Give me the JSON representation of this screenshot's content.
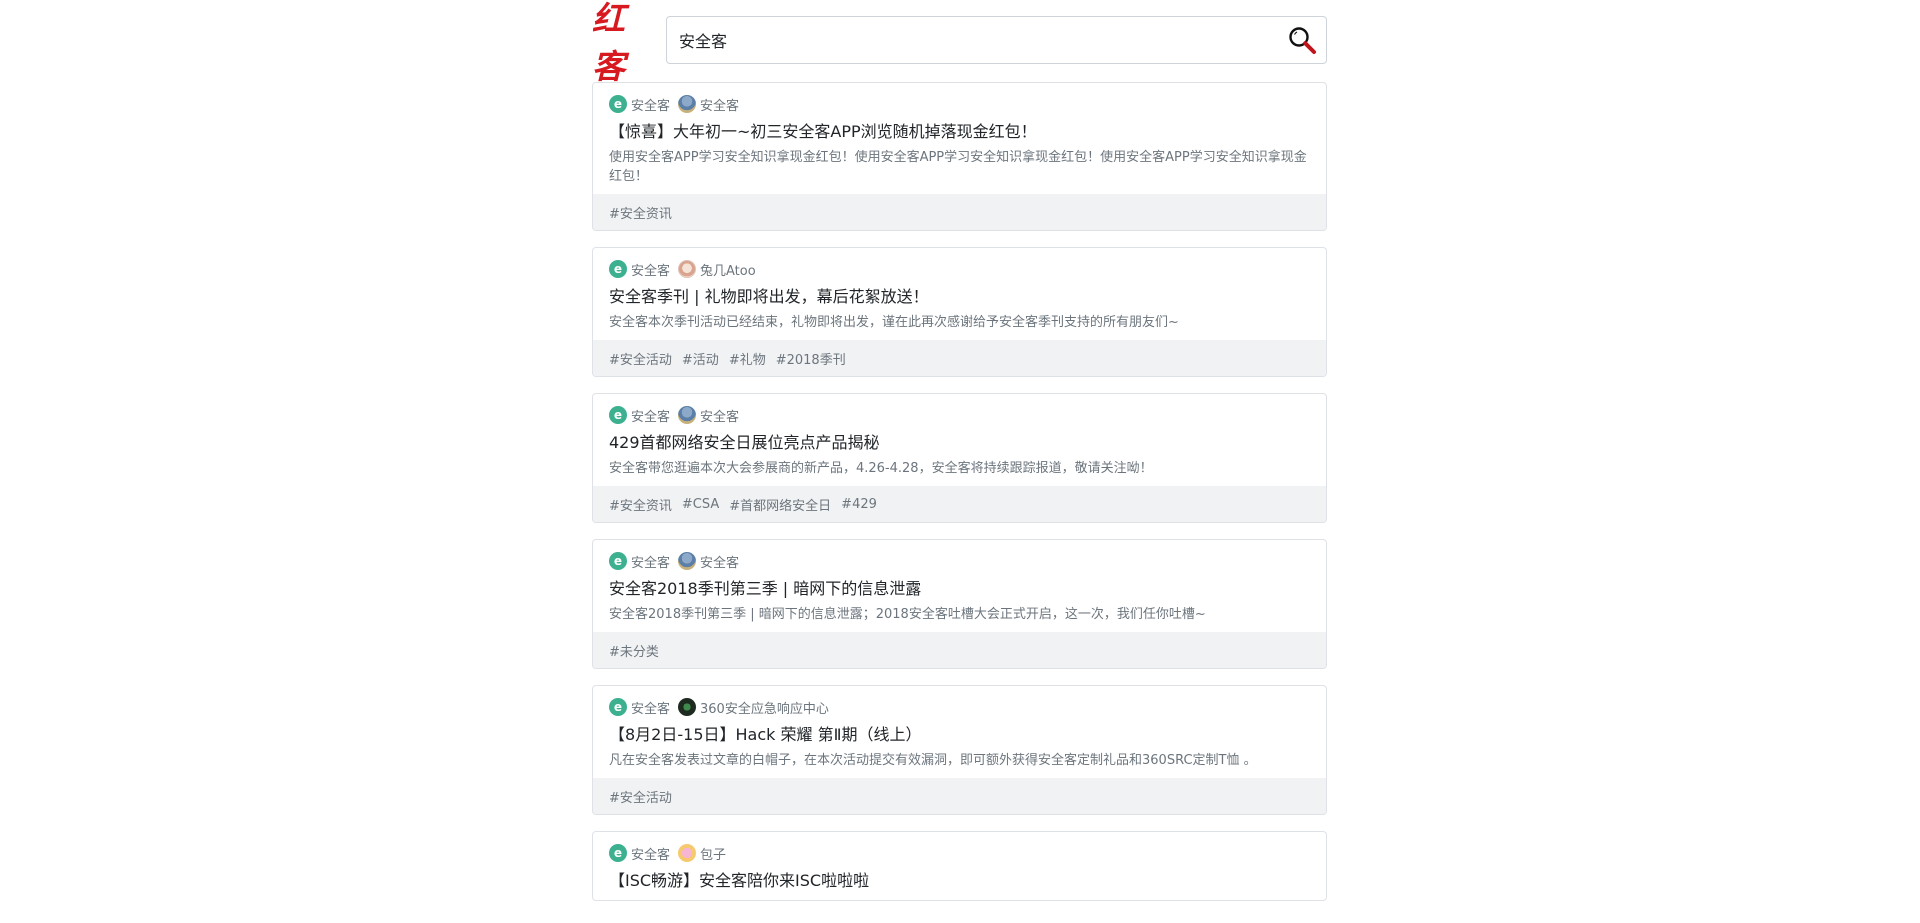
{
  "header": {
    "logo_text": "红客",
    "search": {
      "value": "安全客",
      "placeholder": ""
    }
  },
  "articles": [
    {
      "site": "安全客",
      "author": "安全客",
      "avatar": "robot",
      "title": "【惊喜】大年初一~初三安全客APP浏览随机掉落现金红包！",
      "desc": "使用安全客APP学习安全知识拿现金红包！使用安全客APP学习安全知识拿现金红包！使用安全客APP学习安全知识拿现金红包！",
      "tags": [
        "#安全资讯"
      ]
    },
    {
      "site": "安全客",
      "author": "兔几Atoo",
      "avatar": "rabbit",
      "title": "安全客季刊 | 礼物即将出发，幕后花絮放送！",
      "desc": "安全客本次季刊活动已经结束，礼物即将出发，谨在此再次感谢给予安全客季刊支持的所有朋友们~",
      "tags": [
        "#安全活动",
        "#活动",
        "#礼物",
        "#2018季刊"
      ]
    },
    {
      "site": "安全客",
      "author": "安全客",
      "avatar": "robot",
      "title": "429首都网络安全日展位亮点产品揭秘",
      "desc": "安全客带您逛遍本次大会参展商的新产品，4.26-4.28，安全客将持续跟踪报道，敬请关注呦！",
      "tags": [
        "#安全资讯",
        "#CSA",
        "#首都网络安全日",
        "#429"
      ]
    },
    {
      "site": "安全客",
      "author": "安全客",
      "avatar": "robot",
      "title": "安全客2018季刊第三季 | 暗网下的信息泄露",
      "desc": "安全客2018季刊第三季 | 暗网下的信息泄露；2018安全客吐槽大会正式开启，这一次，我们任你吐槽~",
      "tags": [
        "#未分类"
      ]
    },
    {
      "site": "安全客",
      "author": "360安全应急响应中心",
      "avatar": "dark",
      "title": "【8月2日-15日】Hack 荣耀 第Ⅱ期（线上）",
      "desc": "凡在安全客发表过文章的白帽子，在本次活动提交有效漏洞，即可额外获得安全客定制礼品和360SRC定制T恤 。",
      "tags": [
        "#安全活动"
      ]
    },
    {
      "site": "安全客",
      "author": "包子",
      "avatar": "pink",
      "title": "【ISC畅游】安全客陪你来ISC啦啦啦",
      "desc": "",
      "tags": []
    }
  ],
  "colors": {
    "site_icon": "#3cb08f",
    "logo": "#d71920",
    "tag_bar": "#f1f2f4"
  }
}
